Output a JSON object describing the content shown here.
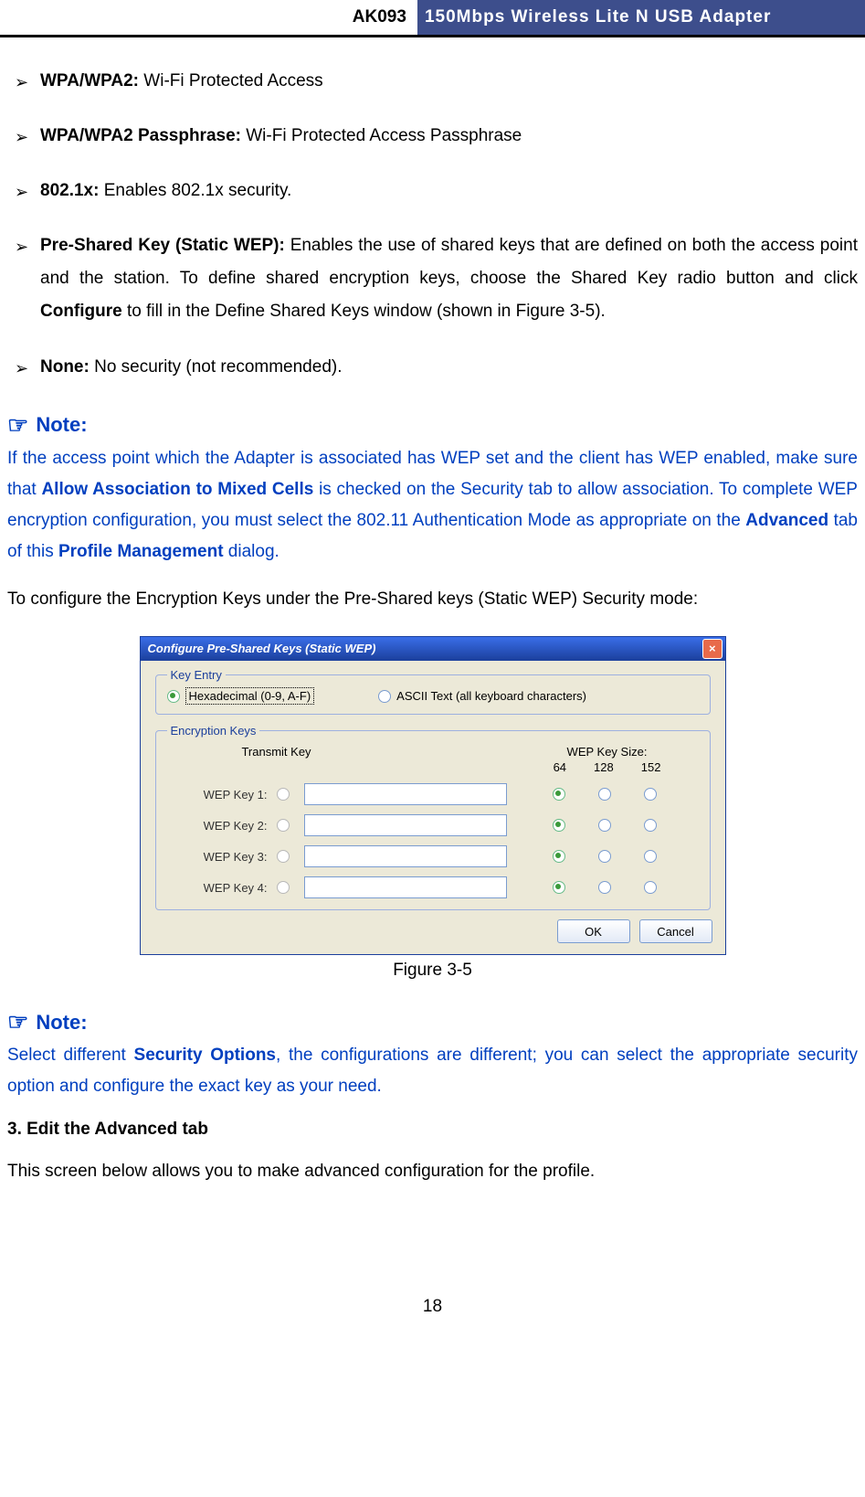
{
  "header": {
    "left": "AK093",
    "right": "150Mbps Wireless Lite N USB Adapter"
  },
  "bullets": [
    {
      "term": "WPA/WPA2:",
      "desc": " Wi-Fi Protected Access"
    },
    {
      "term": "WPA/WPA2 Passphrase:",
      "desc": " Wi-Fi Protected Access Passphrase"
    },
    {
      "term": "802.1x:",
      "desc": " Enables 802.1x security."
    },
    {
      "term": "Pre-Shared Key (Static WEP):",
      "desc": " Enables the use of shared keys that are defined on both the access point and the station. To define shared encryption keys, choose the Shared Key radio button and click ",
      "strong": "Configure",
      "desc2": " to fill in the Define Shared Keys window (shown in Figure 3-5)."
    },
    {
      "term": "None:",
      "desc": " No security (not recommended)."
    }
  ],
  "notes": {
    "label": "Note:",
    "body1a": "If the access point which the Adapter is associated has WEP set and the client has WEP enabled, make sure that ",
    "body1b": "Allow Association to Mixed Cells",
    "body1c": " is checked on the Security tab to allow association. To complete WEP encryption configuration, you must select the 802.11 Authentication Mode as appropriate on the ",
    "body1d": "Advanced",
    "body1e": " tab of this ",
    "body1f": "Profile Management",
    "body1g": " dialog.",
    "body2a": "Select different ",
    "body2b": "Security Options",
    "body2c": ", the configurations are different; you can select the appropriate security option and configure the exact key as your need."
  },
  "preKeysPara": "To configure the Encryption Keys under the Pre-Shared keys (Static WEP) Security mode:",
  "dialog": {
    "title": "Configure Pre-Shared Keys (Static WEP)",
    "legend1": "Key Entry",
    "hex": "Hexadecimal (0-9, A-F)",
    "ascii": "ASCII Text (all keyboard characters)",
    "legend2": "Encryption Keys",
    "transmit": "Transmit Key",
    "sizehdr": "WEP Key Size:",
    "s64": "64",
    "s128": "128",
    "s152": "152",
    "k1": "WEP Key 1:",
    "k2": "WEP Key 2:",
    "k3": "WEP Key 3:",
    "k4": "WEP Key 4:",
    "ok": "OK",
    "cancel": "Cancel"
  },
  "figcap": "Figure 3-5",
  "section3": "3.    Edit the Advanced tab",
  "advPara": "This screen below allows you to make advanced configuration for the profile.",
  "pagenum": "18"
}
